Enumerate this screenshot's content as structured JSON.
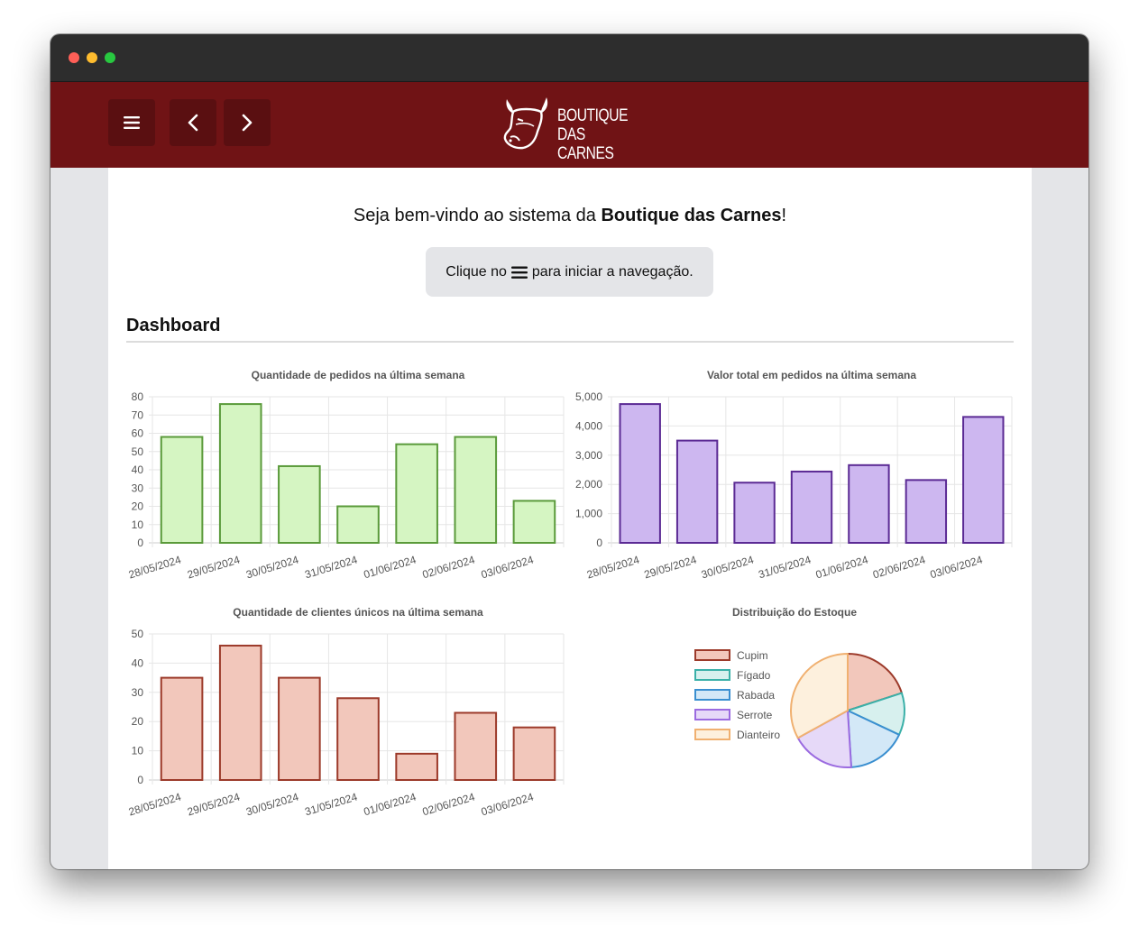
{
  "window": {
    "title": ""
  },
  "header": {
    "menu_icon": "hamburger-icon",
    "back_icon": "chevron-left-icon",
    "forward_icon": "chevron-right-icon",
    "logo_line1": "BOUTIQUE",
    "logo_line2": "DAS CARNES",
    "bg_color": "#701315"
  },
  "welcome": {
    "prefix": "Seja bem-vindo ao sistema da ",
    "brand": "Boutique das Carnes",
    "suffix": "!"
  },
  "hint": {
    "prefix": "Clique no",
    "suffix": "para iniciar a navegação."
  },
  "dashboard": {
    "title": "Dashboard"
  },
  "chart_data": [
    {
      "id": "pedidos",
      "type": "bar",
      "title": "Quantidade de pedidos na última semana",
      "categories": [
        "28/05/2024",
        "29/05/2024",
        "30/05/2024",
        "31/05/2024",
        "01/06/2024",
        "02/06/2024",
        "03/06/2024"
      ],
      "values": [
        58,
        76,
        42,
        20,
        54,
        58,
        23
      ],
      "ylim": [
        0,
        80
      ],
      "yticks": [
        "0",
        "10",
        "20",
        "30",
        "40",
        "50",
        "60",
        "70",
        "80"
      ],
      "fill": "#d5f5c2",
      "stroke": "#5a9a3a",
      "grid": true
    },
    {
      "id": "valor",
      "type": "bar",
      "title": "Valor total em pedidos na última semana",
      "categories": [
        "28/05/2024",
        "29/05/2024",
        "30/05/2024",
        "31/05/2024",
        "01/06/2024",
        "02/06/2024",
        "03/06/2024"
      ],
      "values": [
        4750,
        3500,
        2060,
        2440,
        2660,
        2150,
        4310
      ],
      "ylim": [
        0,
        5000
      ],
      "yticks": [
        "0",
        "1,000",
        "2,000",
        "3,000",
        "4,000",
        "5,000"
      ],
      "fill": "#cdb7f0",
      "stroke": "#5b2a94",
      "grid": true
    },
    {
      "id": "clientes",
      "type": "bar",
      "title": "Quantidade de clientes únicos na última semana",
      "categories": [
        "28/05/2024",
        "29/05/2024",
        "30/05/2024",
        "31/05/2024",
        "01/06/2024",
        "02/06/2024",
        "03/06/2024"
      ],
      "values": [
        35,
        46,
        35,
        28,
        9,
        23,
        18
      ],
      "ylim": [
        0,
        50
      ],
      "yticks": [
        "0",
        "10",
        "20",
        "30",
        "40",
        "50"
      ],
      "fill": "#f2c7bb",
      "stroke": "#9c3a2a",
      "grid": true
    },
    {
      "id": "estoque",
      "type": "pie",
      "title": "Distribuição do Estoque",
      "legend_position": "left",
      "slices": [
        {
          "label": "Cupim",
          "value": 20,
          "fill": "#f2c7bb",
          "stroke": "#9c3a2a"
        },
        {
          "label": "Fígado",
          "value": 12,
          "fill": "#d7f0ee",
          "stroke": "#3ab0a8"
        },
        {
          "label": "Rabada",
          "value": 17,
          "fill": "#d3e8f7",
          "stroke": "#3a8fd0"
        },
        {
          "label": "Serrote",
          "value": 18,
          "fill": "#e6d9f8",
          "stroke": "#9b6be0"
        },
        {
          "label": "Dianteiro",
          "value": 33,
          "fill": "#fdf0dd",
          "stroke": "#f0b070"
        }
      ]
    }
  ]
}
